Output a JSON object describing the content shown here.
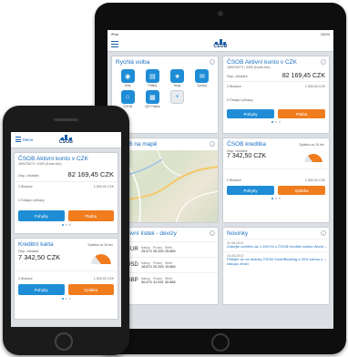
{
  "brand": {
    "name": "ČSOB",
    "blue": "#1a5ea8",
    "accent_blue": "#1f8dd6",
    "accent_orange": "#f07c1e"
  },
  "tablet": {
    "status_left": "iPad",
    "status_right": "100%",
    "quick_actions": {
      "title": "Rychlá volba",
      "items": [
        {
          "label": "Účty",
          "icon": "accounts-icon"
        },
        {
          "label": "Platby",
          "icon": "payments-icon"
        },
        {
          "label": "Moje",
          "icon": "favorites-icon"
        },
        {
          "label": "Zprávy",
          "icon": "messages-icon"
        },
        {
          "label": "ČSOB",
          "icon": "bank-icon"
        },
        {
          "label": "QR Platba",
          "icon": "qr-icon"
        },
        {
          "label": "",
          "icon": "plus-icon"
        }
      ]
    },
    "account": {
      "title": "ČSOB Aktivní konto v CZK",
      "number": "169476273 / 0300 (Karla Jan)",
      "balance_label": "Disp. zůstatek",
      "balance": "82 169,45 CZK",
      "row1_label": "2 Blokace",
      "row1_value": "1 500,00 CZK",
      "row2_label": "0 Čekající příkazy",
      "btn_primary": "Pohyby",
      "btn_secondary": "Platba"
    },
    "map": {
      "title": "ČSOB na mapě"
    },
    "credit": {
      "title": "ČSOB kreditka",
      "due_label": "Splátka za 18 dní",
      "balance_label": "Disp. zůstatek",
      "balance": "7 342,50 CZK",
      "row1_label": "2 Blokace",
      "row1_value": "1 500,00 CZK",
      "btn_primary": "Pohyby",
      "btn_secondary": "Splátka"
    },
    "rates": {
      "title": "Kurzovní lístek - devizy",
      "col_buy": "Nákup",
      "col_mid": "Prodej",
      "col_sell": "Střed",
      "rows": [
        {
          "currency": "EUR",
          "buy": "25.573",
          "mid": "26.253",
          "sell": "25.865"
        },
        {
          "currency": "USD",
          "buy": "18.873",
          "mid": "20.253",
          "sell": "19.865"
        },
        {
          "currency": "GBP",
          "buy": "30.573",
          "mid": "31.091",
          "sell": "30.865"
        }
      ]
    },
    "news": {
      "title": "Novinky",
      "items": [
        {
          "date": "31.08.2013",
          "text": "Získejte odměnu až 1 400 Kč s ČSOB Kreditní kartou World"
        },
        {
          "date": "24.08.2013",
          "text": "Přidejte se na stránky ČSOB SmartBanking a 30% slevou z nákupu zboží"
        }
      ]
    }
  },
  "phone": {
    "menu_label": "Menu",
    "account": {
      "title": "ČSOB Aktivní konto v CZK",
      "number": "169476273 / 0300 (Karla Jan)",
      "balance_label": "Disp. zůstatek",
      "balance": "82 169,45 CZK",
      "row1_label": "2 Blokace",
      "row1_value": "1 500,00 CZK",
      "row2_label": "0 Čekající příkazy",
      "btn_primary": "Pohyby",
      "btn_secondary": "Platba"
    },
    "credit": {
      "title": "Kreditní karta",
      "due_label": "Splátka za 18 dní",
      "balance_label": "Disp. zůstatek",
      "balance": "7 342,50 CZK",
      "row1_label": "2 Blokace",
      "row1_value": "1 500,00 CZK",
      "btn_primary": "Pohyby",
      "btn_secondary": "Splátka"
    }
  }
}
